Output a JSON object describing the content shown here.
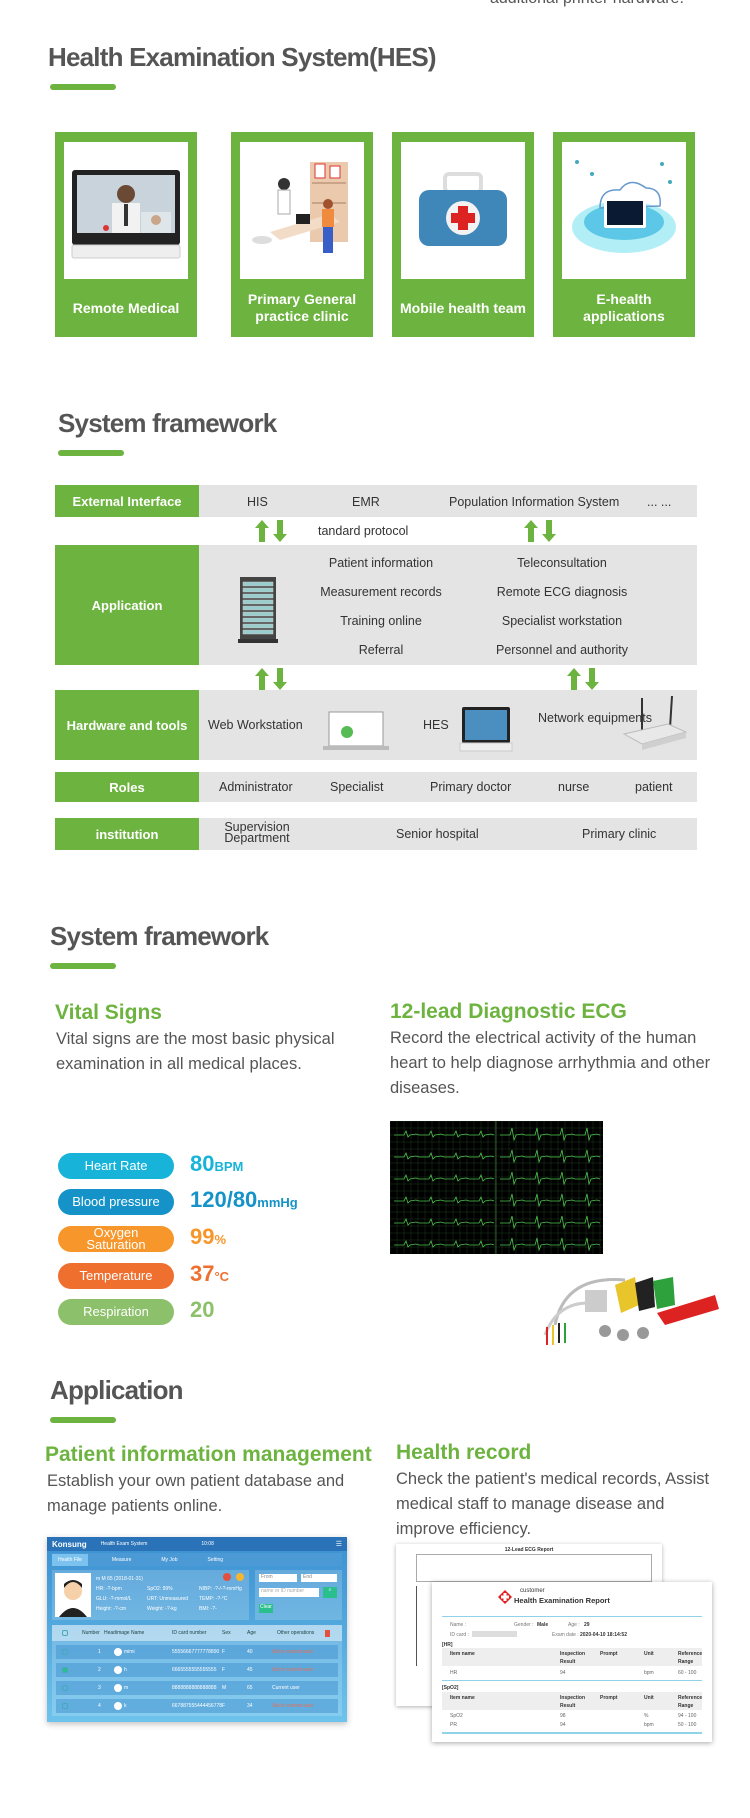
{
  "top_cut_text": "additional printer hardware.",
  "hes": {
    "title": "Health Examination System(HES)",
    "cards": [
      {
        "label": "Remote Medical",
        "image": "telemedicine-tablet"
      },
      {
        "label": "Primary General practice clinic",
        "image": "clinic-illustration"
      },
      {
        "label": "Mobile health team",
        "image": "medical-kit"
      },
      {
        "label": "E-health applications",
        "image": "cloud-tablet"
      }
    ]
  },
  "framework": {
    "title": "System framework",
    "external": {
      "head": "External Interface",
      "items": [
        "HIS",
        "EMR",
        "Population Information System",
        "... ..."
      ]
    },
    "protocol": "tandard protocol",
    "application": {
      "head": "Application",
      "left": [
        "Patient information",
        "Measurement records",
        "Training online",
        "Referral"
      ],
      "right": [
        "Teleconsultation",
        "Remote ECG diagnosis",
        "Specialist workstation",
        "Personnel and authority"
      ]
    },
    "hardware": {
      "head": "Hardware and tools",
      "items": [
        "Web Workstation",
        "HES",
        "Network equipments"
      ]
    },
    "roles": {
      "head": "Roles",
      "items": [
        "Administrator",
        "Specialist",
        "Primary doctor",
        "nurse",
        "patient"
      ]
    },
    "institution": {
      "head": "institution",
      "items": [
        "Supervision Department",
        "Senior hospital",
        "Primary clinic"
      ]
    }
  },
  "vitals_section": {
    "title": "System framework",
    "vital": {
      "heading": "Vital Signs",
      "text": "Vital signs are the most basic physical examination in all medical places.",
      "items": [
        {
          "label": "Heart Rate",
          "value": "80",
          "unit": "BPM",
          "color": "#17b3d8"
        },
        {
          "label": "Blood pressure",
          "value": "120/80",
          "unit": "mmHg",
          "color": "#1593c9"
        },
        {
          "label": "Oxygen Saturation",
          "value": "99",
          "unit": "%",
          "color": "#f7962a"
        },
        {
          "label": "Temperature",
          "value": "37",
          "unit": "°C",
          "color": "#ef6f2e"
        },
        {
          "label": "Respiration",
          "value": "20",
          "unit": "",
          "color": "#8cc06a"
        }
      ]
    },
    "ecg": {
      "heading": "12-lead Diagnostic ECG",
      "text": "Record the electrical activity of the human heart to help diagnose arrhythmia and other diseases."
    }
  },
  "application": {
    "title": "Application",
    "patient_mgmt": {
      "heading": "Patient information management",
      "text": "Establish your own patient database and manage patients online.",
      "screenshot": {
        "brand": "Konsung",
        "app_title": "Health Exam System",
        "time": "10:08",
        "tabs": [
          "Health File",
          "Measure",
          "My Job",
          "Setting"
        ],
        "patient_lines": [
          "m M 65 (2018-01-31)",
          "HR: -?-bpm",
          "SpO2: 99%",
          "NIBP: -?-/-?-mmHg",
          "GLU: -?-mmol/L",
          "URT: Unmeasured",
          "TEMP: -?-°C",
          "Height: -?-cm",
          "Weight: -?-kg",
          "BMI: -?-"
        ],
        "search": {
          "from": "From",
          "end": "End",
          "placeholder": "name or ID number",
          "clear": "Clear"
        },
        "columns": [
          "Number",
          "Headimage Name",
          "ID card number",
          "Sex",
          "Age",
          "Other operations"
        ],
        "rows": [
          {
            "num": "1",
            "name": "mimi",
            "id": "55556667777778890",
            "sex": "F",
            "age": "40",
            "op": "Set to current user",
            "checked": false
          },
          {
            "num": "2",
            "name": "h",
            "id": "6665555555555555",
            "sex": "F",
            "age": "45",
            "op": "Set to current user",
            "checked": true
          },
          {
            "num": "3",
            "name": "m",
            "id": "8888888888888888",
            "sex": "M",
            "age": "65",
            "op": "Current user",
            "checked": false
          },
          {
            "num": "4",
            "name": "k",
            "id": "667887555444456778",
            "sex": "F",
            "age": "34",
            "op": "Set to current user",
            "checked": false
          }
        ]
      }
    },
    "health_record": {
      "heading": "Health record",
      "text": "Check the patient's medical records, Assist medical staff to manage disease and improve efficiency.",
      "report_back_title": "12-Lead ECG Report",
      "report": {
        "org": "customer",
        "title": "Health Examination Report",
        "name_label": "Name :",
        "gender_label": "Gender :",
        "gender": "Male",
        "age_label": "Age :",
        "age": "29",
        "id_label": "ID card :",
        "date_label": "Exam date :",
        "date": "2020-04-10 18:14:52",
        "hr_section": "[HR]",
        "spo2_section": "[SpO2]",
        "cols": [
          "Item name",
          "Inspection Result",
          "Prompt",
          "Unit",
          "Reference Range"
        ],
        "hr_rows": [
          {
            "item": "HR",
            "result": "94",
            "unit": "bpm",
            "range": "60 - 100"
          }
        ],
        "spo2_rows": [
          {
            "item": "SpO2",
            "result": "98",
            "unit": "%",
            "range": "94 - 100"
          },
          {
            "item": "PR",
            "result": "94",
            "unit": "bpm",
            "range": "50 - 100"
          }
        ]
      }
    }
  }
}
